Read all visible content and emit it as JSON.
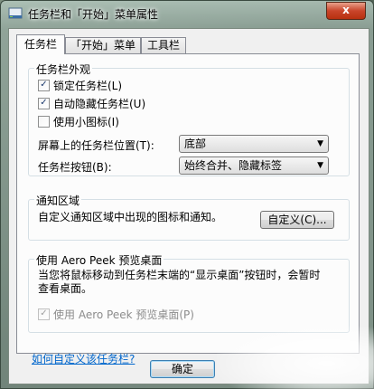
{
  "window": {
    "title": "任务栏和「开始」菜单属性",
    "close_label": "x"
  },
  "tabs": [
    {
      "label": "任务栏"
    },
    {
      "label": "「开始」菜单"
    },
    {
      "label": "工具栏"
    }
  ],
  "appearance": {
    "title": "任务栏外观",
    "lock_label": "锁定任务栏(L)",
    "autohide_label": "自动隐藏任务栏(U)",
    "small_icons_label": "使用小图标(I)",
    "lock_checked": true,
    "autohide_checked": true,
    "small_icons_checked": false,
    "position_label": "屏幕上的任务栏位置(T):",
    "position_value": "底部",
    "buttons_label": "任务栏按钮(B):",
    "buttons_value": "始终合并、隐藏标签"
  },
  "notify": {
    "title": "通知区域",
    "description": "自定义通知区域中出现的图标和通知。",
    "customize_button": "自定义(C)..."
  },
  "aero": {
    "title": "使用 Aero Peek 预览桌面",
    "description_line1": "当您将鼠标移动到任务栏末端的“显示桌面”按钮时，会暂时",
    "description_line2": "查看桌面。",
    "checkbox_label": "使用 Aero Peek 预览桌面(P)",
    "checked": true
  },
  "help_link": "如何自定义该任务栏?",
  "ok_button": "确定",
  "check_mark": "✓"
}
